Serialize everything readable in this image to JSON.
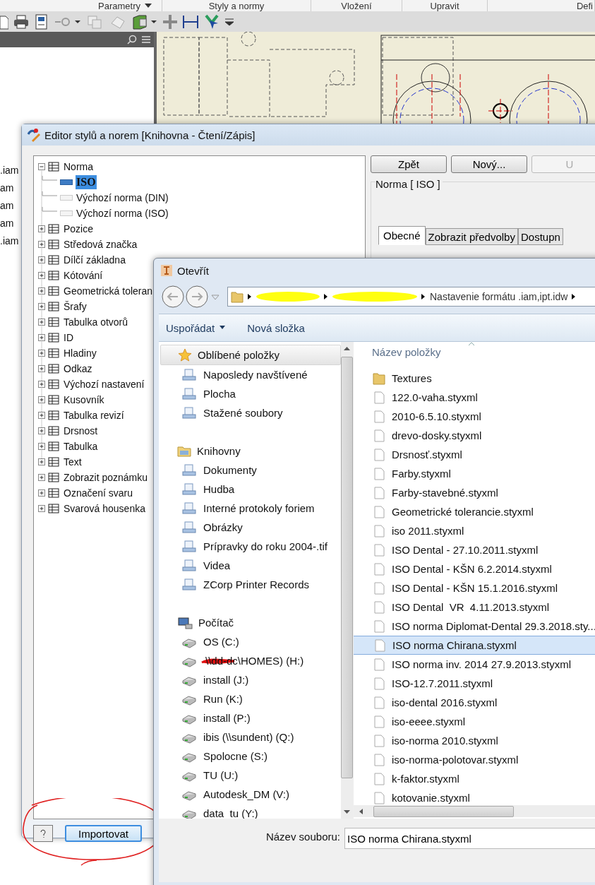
{
  "ribbon_tabs": [
    {
      "label": "Parametry",
      "dropdown": true
    },
    {
      "label": "Styly a normy",
      "dropdown": false
    },
    {
      "label": "Vložení",
      "dropdown": false
    },
    {
      "label": "Upravit",
      "dropdown": false
    },
    {
      "label": "Defi",
      "dropdown": false
    }
  ],
  "browser_panel": {
    "items": [
      ".iam",
      "am",
      "am",
      "am",
      ".iam"
    ]
  },
  "style_editor": {
    "title": "Editor stylů a norem [Knihovna - Čtení/Zápis]",
    "tree": [
      {
        "label": "Norma",
        "expanded": true,
        "selected": false,
        "children": [
          {
            "label": "ISO",
            "selected": true
          },
          {
            "label": "Výchozí norma (DIN)",
            "selected": false
          },
          {
            "label": "Výchozí norma (ISO)",
            "selected": false
          }
        ]
      },
      {
        "label": "Pozice",
        "expanded": false,
        "selected": false
      },
      {
        "label": "Středová značka",
        "expanded": false,
        "selected": false
      },
      {
        "label": "Dílčí základna",
        "expanded": false,
        "selected": false
      },
      {
        "label": "Kótování",
        "expanded": false,
        "selected": false
      },
      {
        "label": "Geometrická toleran",
        "expanded": false,
        "selected": false
      },
      {
        "label": "Šrafy",
        "expanded": false,
        "selected": false
      },
      {
        "label": "Tabulka otvorů",
        "expanded": false,
        "selected": false
      },
      {
        "label": "ID",
        "expanded": false,
        "selected": false
      },
      {
        "label": "Hladiny",
        "expanded": false,
        "selected": false
      },
      {
        "label": "Odkaz",
        "expanded": false,
        "selected": false
      },
      {
        "label": "Výchozí nastavení",
        "expanded": false,
        "selected": false
      },
      {
        "label": "Kusovník",
        "expanded": false,
        "selected": false
      },
      {
        "label": "Tabulka revizí",
        "expanded": false,
        "selected": false
      },
      {
        "label": "Drsnost",
        "expanded": false,
        "selected": false
      },
      {
        "label": "Tabulka",
        "expanded": false,
        "selected": false
      },
      {
        "label": "Text",
        "expanded": false,
        "selected": false
      },
      {
        "label": "Zobrazit poznámku",
        "expanded": false,
        "selected": false
      },
      {
        "label": "Označení svaru",
        "expanded": false,
        "selected": false
      },
      {
        "label": "Svarová housenka",
        "expanded": false,
        "selected": false
      }
    ],
    "buttons": [
      {
        "label": "Zpět",
        "disabled": false
      },
      {
        "label": "Nový...",
        "disabled": false
      },
      {
        "label": "U",
        "disabled": true
      }
    ],
    "heading": "Norma [ ISO ]",
    "tabs": [
      {
        "label": "Obecné",
        "selected": true
      },
      {
        "label": "Zobrazit předvolby",
        "selected": false
      },
      {
        "label": "Dostupn",
        "selected": false
      }
    ],
    "import_button": "Importovat"
  },
  "open_dialog": {
    "title": "Otevřít",
    "breadcrumb": "Nastavenie formátu .iam,ipt.idw",
    "toolbar": [
      {
        "label": "Uspořádat",
        "dropdown": true
      },
      {
        "label": "Nová složka",
        "dropdown": false
      }
    ],
    "nav_groups": [
      {
        "label": "Oblíbené položky",
        "selected": true,
        "children": [
          {
            "label": "Naposledy navštívené",
            "selected": false,
            "redacted": false
          },
          {
            "label": "Plocha",
            "selected": false,
            "redacted": false
          },
          {
            "label": "Stažené soubory",
            "selected": false,
            "redacted": false
          }
        ]
      },
      {
        "label": "Knihovny",
        "selected": false,
        "children": [
          {
            "label": "Dokumenty",
            "selected": false,
            "redacted": false
          },
          {
            "label": "Hudba",
            "selected": false,
            "redacted": false
          },
          {
            "label": "Interné protokoly foriem",
            "selected": false,
            "redacted": false
          },
          {
            "label": "Obrázky",
            "selected": false,
            "redacted": false
          },
          {
            "label": "Prípravky do roku 2004-.tif",
            "selected": false,
            "redacted": false
          },
          {
            "label": "Videa",
            "selected": false,
            "redacted": false
          },
          {
            "label": "ZCorp Printer Records",
            "selected": false,
            "redacted": false
          }
        ]
      },
      {
        "label": "Počítač",
        "selected": false,
        "children": [
          {
            "label": "OS (C:)",
            "selected": false,
            "redacted": false
          },
          {
            "label": "\\\\dd-dc\\HOMES) (H:)",
            "selected": false,
            "redacted": true
          },
          {
            "label": "install (J:)",
            "selected": false,
            "redacted": false
          },
          {
            "label": "Run (K:)",
            "selected": false,
            "redacted": false
          },
          {
            "label": "install (P:)",
            "selected": false,
            "redacted": false
          },
          {
            "label": "ibis (\\\\sundent) (Q:)",
            "selected": false,
            "redacted": false
          },
          {
            "label": "Spolocne (S:)",
            "selected": false,
            "redacted": false
          },
          {
            "label": "TU (U:)",
            "selected": false,
            "redacted": false
          },
          {
            "label": "Autodesk_DM (V:)",
            "selected": false,
            "redacted": false
          },
          {
            "label": "data_tu (Y:)",
            "selected": false,
            "redacted": false
          }
        ]
      }
    ],
    "column_header": "Název položky",
    "files": [
      {
        "name": "Textures",
        "kind": "folder",
        "selected": false
      },
      {
        "name": "122.0-vaha.styxml",
        "kind": "file",
        "selected": false
      },
      {
        "name": "2010-6.5.10.styxml",
        "kind": "file",
        "selected": false
      },
      {
        "name": "drevo-dosky.styxml",
        "kind": "file",
        "selected": false
      },
      {
        "name": "Drsnosť.styxml",
        "kind": "file",
        "selected": false
      },
      {
        "name": "Farby.styxml",
        "kind": "file",
        "selected": false
      },
      {
        "name": "Farby-stavebné.styxml",
        "kind": "file",
        "selected": false
      },
      {
        "name": "Geometrické tolerancie.styxml",
        "kind": "file",
        "selected": false
      },
      {
        "name": "iso 2011.styxml",
        "kind": "file",
        "selected": false
      },
      {
        "name": "ISO Dental - 27.10.2011.styxml",
        "kind": "file",
        "selected": false
      },
      {
        "name": "ISO Dental - KŠN 6.2.2014.styxml",
        "kind": "file",
        "selected": false
      },
      {
        "name": "ISO Dental - KŠN 15.1.2016.styxml",
        "kind": "file",
        "selected": false
      },
      {
        "name": "ISO Dental  VR  4.11.2013.styxml",
        "kind": "file",
        "selected": false
      },
      {
        "name": "ISO norma Diplomat-Dental 29.3.2018.sty...",
        "kind": "file",
        "selected": false
      },
      {
        "name": "ISO norma Chirana.styxml",
        "kind": "file",
        "selected": true
      },
      {
        "name": "ISO norma inv. 2014 27.9.2013.styxml",
        "kind": "file",
        "selected": false
      },
      {
        "name": "ISO-12.7.2011.styxml",
        "kind": "file",
        "selected": false
      },
      {
        "name": "iso-dental 2016.styxml",
        "kind": "file",
        "selected": false
      },
      {
        "name": "iso-eeee.styxml",
        "kind": "file",
        "selected": false
      },
      {
        "name": "iso-norma 2010.styxml",
        "kind": "file",
        "selected": false
      },
      {
        "name": "iso-norma-polotovar.styxml",
        "kind": "file",
        "selected": false
      },
      {
        "name": "k-faktor.styxml",
        "kind": "file",
        "selected": false
      },
      {
        "name": "kotovanie.styxml",
        "kind": "file",
        "selected": false
      }
    ],
    "filename_label": "Název souboru:",
    "filename": "ISO norma Chirana.styxml"
  }
}
